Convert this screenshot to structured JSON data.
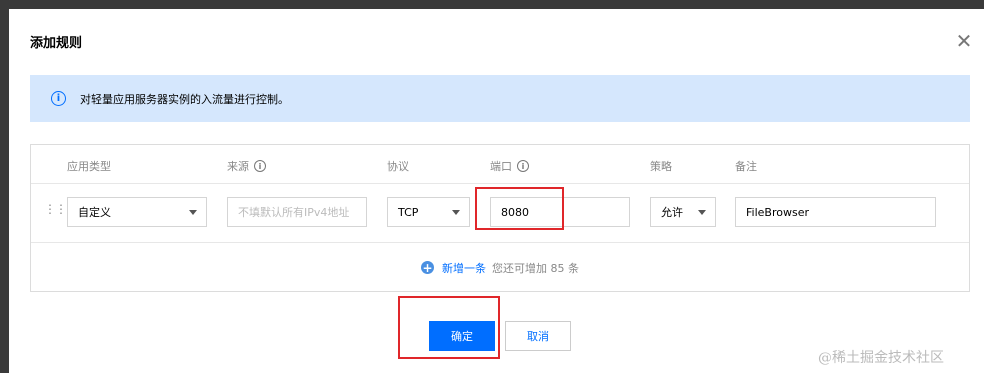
{
  "dialog": {
    "title": "添加规则",
    "close_symbol": "✕"
  },
  "notice": {
    "icon": "info-icon",
    "icon_glyph": "i",
    "text": "对轻量应用服务器实例的入流量进行控制。"
  },
  "table": {
    "headers": {
      "app_type": "应用类型",
      "source": "来源",
      "protocol": "协议",
      "port": "端口",
      "policy": "策略",
      "remark": "备注"
    },
    "row": {
      "app_type": "自定义",
      "source_placeholder": "不填默认所有IPv4地址",
      "protocol": "TCP",
      "port": "8080",
      "policy": "允许",
      "remark": "FileBrowser"
    },
    "add": {
      "label": "新增一条",
      "hint": "您还可增加 85 条"
    }
  },
  "buttons": {
    "confirm": "确定",
    "cancel": "取消"
  },
  "colors": {
    "accent": "#006eff",
    "notice_bg": "#d5e7fd",
    "highlight": "#e0262a"
  },
  "watermark": "@稀土掘金技术社区"
}
